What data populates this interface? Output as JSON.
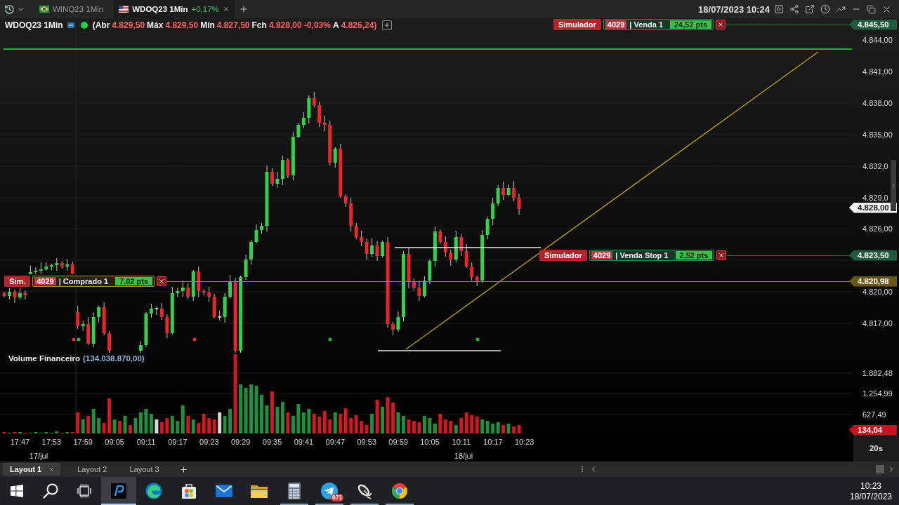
{
  "tabs": [
    {
      "label": "WINQ23 1Min",
      "selected": false
    },
    {
      "label": "WDOQ23 1Min",
      "change": "+0,17%",
      "selected": true
    }
  ],
  "datetime": "18/07/2023 10:24",
  "quote": {
    "symbol": "WDOQ23 1Min",
    "fields": [
      {
        "label": "(Abr",
        "value": "4.829,50"
      },
      {
        "label": "Máx",
        "value": "4.829,50"
      },
      {
        "label": "Mín",
        "value": "4.827,50"
      },
      {
        "label": "Fch",
        "value": "4.828,00 -0,03%"
      },
      {
        "label": "A",
        "value": "4.826,24)"
      }
    ]
  },
  "orders": [
    {
      "kind": "sell",
      "account": "Simulador",
      "id": "4029",
      "side": "| Venda 1",
      "points": "24,52 pts",
      "price": "4.845,50"
    },
    {
      "kind": "sell",
      "account": "Simulador",
      "id": "4029",
      "side": "| Venda Stop 1",
      "points": "2,52 pts",
      "price": "4.823,50"
    },
    {
      "kind": "position",
      "account": "Sim.",
      "id": "4029",
      "side": "| Comprado 1",
      "points": "7.02 pts",
      "price": "4.820,98"
    }
  ],
  "price_axis": {
    "ticks": [
      "4.844,00",
      "4.841,00",
      "4.838,00",
      "4.835,00",
      "4.832,0",
      "4.829,0",
      "4.826,00",
      "4.820,00",
      "4.817,00"
    ],
    "last_price": "4.828,00"
  },
  "volume": {
    "label": "Volume Financeiro",
    "value": "(134.038.870,00)",
    "ticks": [
      "1.882,48",
      "1.254,99",
      "627,49"
    ],
    "last": "134,04"
  },
  "time_axis": {
    "ticks": [
      "17:47",
      "17:53",
      "17:59",
      "09:05",
      "09:11",
      "09:17",
      "09:23",
      "09:29",
      "09:35",
      "09:41",
      "09:47",
      "09:53",
      "09:59",
      "10:05",
      "10:11",
      "10:17",
      "10:23"
    ],
    "dates": [
      "17/jul",
      "18/jul"
    ]
  },
  "interval": "20s",
  "layouts": [
    {
      "label": "Layout 1",
      "selected": true
    },
    {
      "label": "Layout 2",
      "selected": false
    },
    {
      "label": "Layout 3",
      "selected": false
    }
  ],
  "taskbar": {
    "apps": [
      {
        "kind": "profit",
        "running": true,
        "selected": true
      },
      {
        "kind": "edge",
        "running": false,
        "selected": false
      },
      {
        "kind": "store",
        "running": false,
        "selected": false
      },
      {
        "kind": "mail",
        "running": false,
        "selected": false
      },
      {
        "kind": "explorer",
        "running": false,
        "selected": false
      },
      {
        "kind": "calculator",
        "running": true,
        "selected": false
      },
      {
        "kind": "telegram",
        "running": true,
        "selected": false,
        "badge": "671"
      },
      {
        "kind": "dish",
        "running": true,
        "selected": false
      },
      {
        "kind": "chrome",
        "running": true,
        "selected": false
      }
    ],
    "time": "10:23",
    "date": "18/07/2023"
  }
}
